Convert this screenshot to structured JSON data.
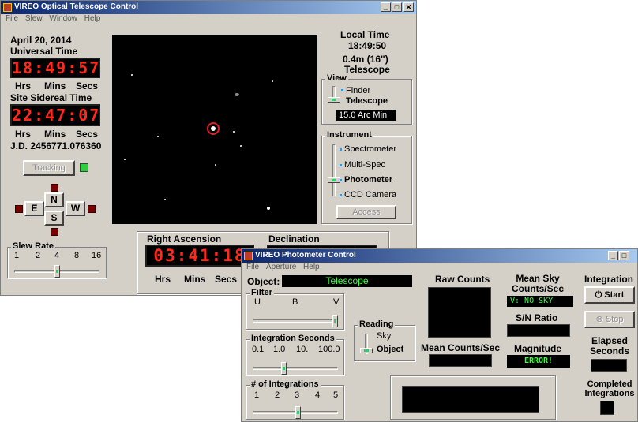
{
  "telescope_window": {
    "title": "VIREO Optical Telescope Control",
    "menu": [
      "File",
      "Slew",
      "Window",
      "Help"
    ],
    "date": "April 20, 2014",
    "ut_label": "Universal Time",
    "ut_value": "18:49:57",
    "hms_labels": [
      "Hrs",
      "Mins",
      "Secs"
    ],
    "sidereal_label": "Site Sidereal Time",
    "sidereal_value": "22:47:07",
    "jd": "J.D. 2456771.076360",
    "tracking_label": "Tracking",
    "dir_buttons": {
      "n": "N",
      "s": "S",
      "e": "E",
      "w": "W"
    },
    "slew_rate_label": "Slew Rate",
    "slew_rate_ticks": [
      "1",
      "2",
      "4",
      "8",
      "16"
    ],
    "slew_rate_selected": "4",
    "local_time_label": "Local Time",
    "local_time_value": "18:49:50",
    "scope_size": "0.4m (16\")",
    "scope_label": "Telescope",
    "view_label": "View",
    "view_options": [
      "Finder",
      "Telescope"
    ],
    "view_selected": "Telescope",
    "fov_value": "15.0 Arc Min",
    "instrument_label": "Instrument",
    "instrument_options": [
      "Spectrometer",
      "Multi-Spec",
      "Photometer",
      "CCD Camera"
    ],
    "instrument_selected": "Photometer",
    "access_label": "Access",
    "ra_label": "Right Ascension",
    "ra_value": "03:41:18",
    "dec_label": "Declination",
    "ra_units": [
      "Hrs",
      "Mins",
      "Secs"
    ]
  },
  "photometer_window": {
    "title": "VIREO Photometer Control",
    "menu": [
      "File",
      "Aperture",
      "Help"
    ],
    "object_label": "Object:",
    "object_value": "Telescope",
    "filter_label": "Filter",
    "filter_options": [
      "U",
      "B",
      "V"
    ],
    "filter_selected": "V",
    "integration_seconds_label": "Integration Seconds",
    "integration_seconds_options": [
      "0.1",
      "1.0",
      "10.",
      "100.0"
    ],
    "integration_seconds_selected": "1.0",
    "num_integrations_label": "# of Integrations",
    "num_integrations_options": [
      "1",
      "2",
      "3",
      "4",
      "5"
    ],
    "num_integrations_selected": "3",
    "reading_label": "Reading",
    "reading_options": [
      "Sky",
      "Object"
    ],
    "reading_selected": "Object",
    "raw_counts_label": "Raw Counts",
    "mean_counts_label": "Mean Counts/Sec",
    "mean_sky_label": "Mean Sky Counts/Sec",
    "mean_sky_value": "V: NO SKY",
    "sn_ratio_label": "S/N Ratio",
    "magnitude_label": "Magnitude",
    "magnitude_value": "ERROR!",
    "integration_label": "Integration",
    "start_label": "Start",
    "stop_label": "Stop",
    "elapsed_label": "Elapsed Seconds",
    "completed_label": "Completed Integrations"
  }
}
